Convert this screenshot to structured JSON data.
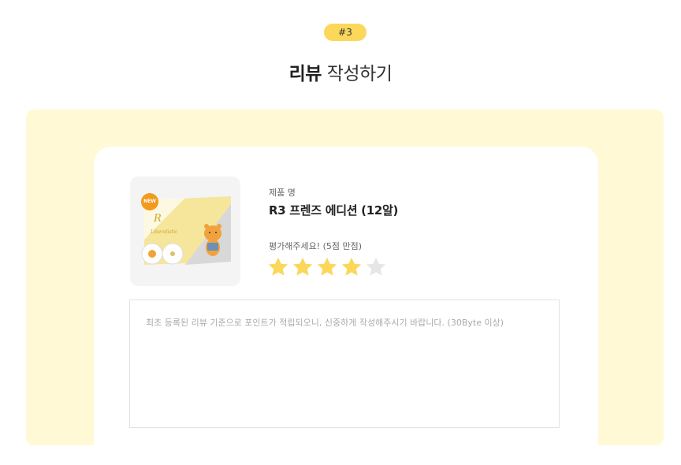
{
  "step": {
    "badge": "#3"
  },
  "heading": {
    "bold": "리뷰",
    "rest": " 작성하기"
  },
  "product": {
    "name_label": "제품 명",
    "name": "R3 프렌즈 에디션 (12알)",
    "image_badge": "NEW"
  },
  "rating": {
    "label": "평가해주세요! (5점 만점)",
    "value": 4,
    "max": 5,
    "filled_color": "#fbd75a",
    "empty_color": "#e6e6e6"
  },
  "review": {
    "placeholder": "최초 등록된 리뷰 기준으로 포인트가 적립되오니, 신중하게 작성해주시기 바랍니다. (30Byte 이상)",
    "value": ""
  },
  "colors": {
    "accent": "#fbd75a",
    "panel_bg": "#fff9d6"
  }
}
